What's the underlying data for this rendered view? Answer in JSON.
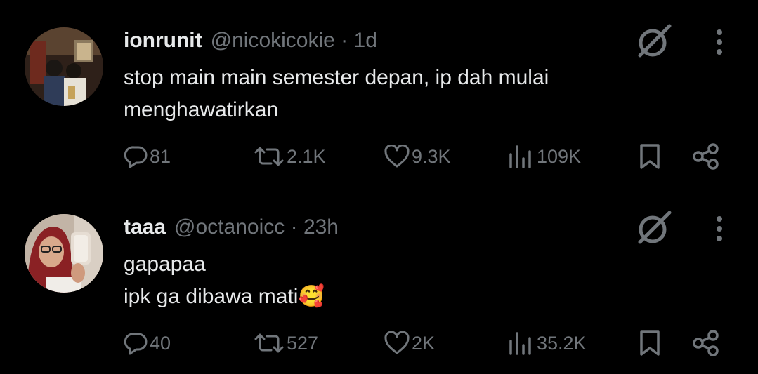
{
  "tweets": [
    {
      "display_name": "ionrunit",
      "handle": "@nicokicokie",
      "separator": "·",
      "time": "1d",
      "text_lines": [
        "stop main main semester depan, ip dah mulai",
        "menghawatirkan"
      ],
      "replies": "81",
      "reposts": "2.1K",
      "likes": "9.3K",
      "views": "109K"
    },
    {
      "display_name": "taaa",
      "handle": "@octanoicc",
      "separator": "·",
      "time": "23h",
      "text_lines": [
        "gapapaa",
        "ipk ga dibawa mati🥰"
      ],
      "replies": "40",
      "reposts": "527",
      "likes": "2K",
      "views": "35.2K"
    }
  ],
  "icons": {
    "grok": "grok-icon",
    "more": "more-vertical-icon",
    "reply": "reply-icon",
    "repost": "repost-icon",
    "like": "heart-icon",
    "views": "views-icon",
    "bookmark": "bookmark-icon",
    "share": "share-icon"
  },
  "colors": {
    "background": "#000000",
    "primary_text": "#e7e9ea",
    "secondary_text": "#71767b"
  }
}
